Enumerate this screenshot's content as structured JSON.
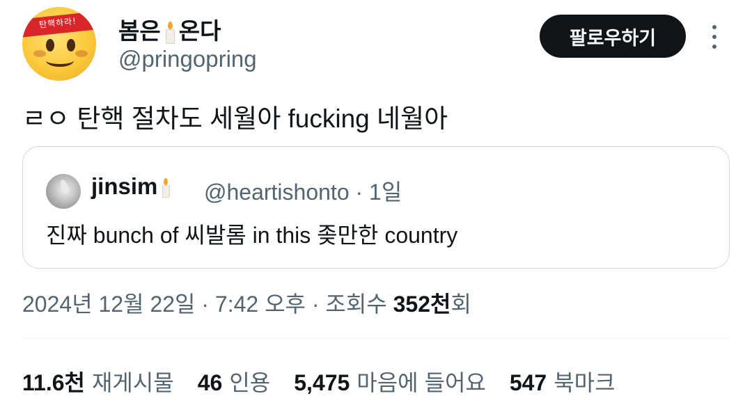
{
  "author": {
    "display_name_part1": "봄은",
    "display_name_part2": "온다",
    "handle": "@pringopring",
    "avatar_band_text": "탄핵하라!"
  },
  "header": {
    "follow_label": "팔로우하기"
  },
  "tweet": {
    "text": "ㄹㅇ 탄핵 절차도 세월아 fucking 네월아"
  },
  "quote": {
    "name": "jinsim",
    "handle_time": "@heartishonto · 1일",
    "text": "진짜 bunch of 씨발롬 in this 좆만한 country"
  },
  "meta": {
    "datetime": "2024년 12월 22일 · 7:42 오후 · 조회수 ",
    "views_number": "352천",
    "views_suffix": "회"
  },
  "stats": [
    {
      "value": "11.6천",
      "label": "재게시물"
    },
    {
      "value": "46",
      "label": "인용"
    },
    {
      "value": "5,475",
      "label": "마음에 들어요"
    },
    {
      "value": "547",
      "label": "북마크"
    }
  ],
  "icons": [
    "candle-emoji-icon",
    "more-icon"
  ]
}
